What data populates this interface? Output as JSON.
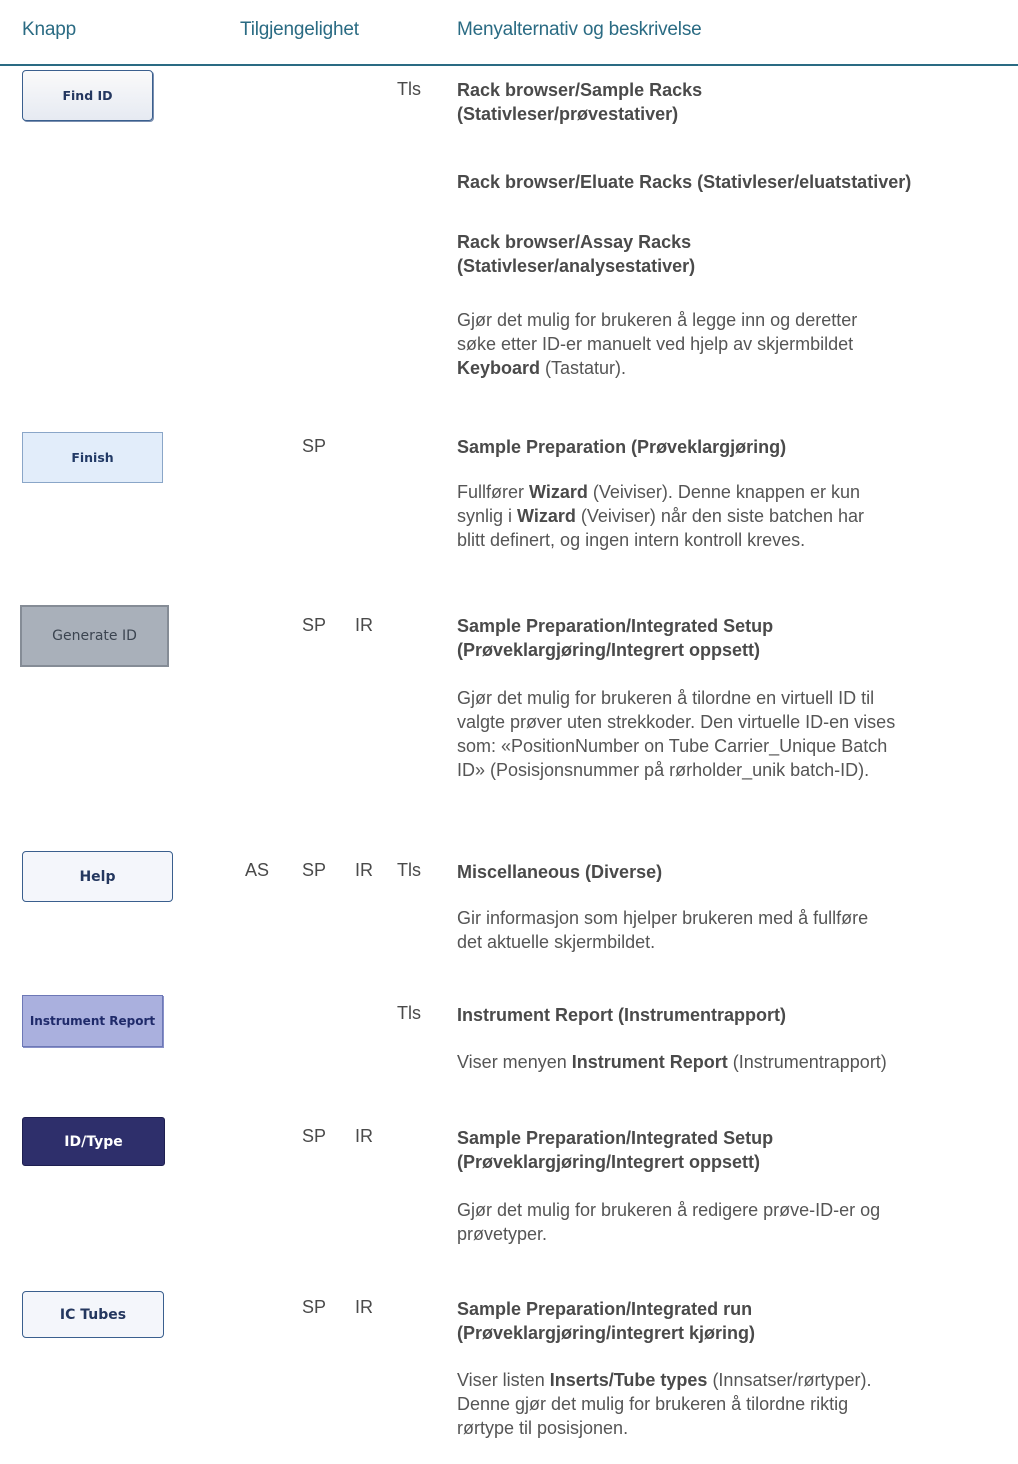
{
  "header": {
    "col_button": "Knapp",
    "col_availability": "Tilgjengelighet",
    "col_menu": "Menyalternativ og beskrivelse"
  },
  "rows": [
    {
      "button": "Find ID",
      "avail": [
        "",
        "",
        "",
        "Tls"
      ],
      "titles": [
        "Rack browser/Sample Racks",
        "(Stativleser/prøvestativer)",
        "Rack browser/Eluate Racks (Stativleser/eluatstativer)",
        "Rack browser/Assay Racks",
        "(Stativleser/analysestativer)"
      ],
      "desc": [
        "Gjør det mulig for brukeren å legge inn og deretter",
        "søke etter ID-er manuelt ved hjelp av skjermbildet",
        "Keyboard",
        " (Tastatur)."
      ]
    },
    {
      "button": "Finish",
      "avail": [
        "",
        "SP",
        "",
        ""
      ],
      "titles": [
        "Sample Preparation (Prøveklargjøring)"
      ],
      "desc": [
        "Fullfører ",
        "Wizard",
        " (Veiviser). Denne knappen er kun",
        "synlig i ",
        "Wizard",
        " (Veiviser) når den siste batchen har",
        "blitt definert, og ingen intern kontroll kreves."
      ]
    },
    {
      "button": "Generate ID",
      "avail": [
        "",
        "SP",
        "IR",
        ""
      ],
      "titles": [
        "Sample Preparation/Integrated Setup",
        "(Prøveklargjøring/Integrert oppsett)"
      ],
      "desc": [
        "Gjør det mulig for brukeren å tilordne en virtuell ID til",
        "valgte prøver uten strekkoder. Den virtuelle ID-en vises",
        "som: «PositionNumber on Tube Carrier_Unique Batch",
        "ID» (Posisjonsnummer på rørholder_unik batch-ID)."
      ]
    },
    {
      "button": "Help",
      "avail": [
        "AS",
        "SP",
        "IR",
        "Tls"
      ],
      "titles": [
        "Miscellaneous (Diverse)"
      ],
      "desc": [
        "Gir informasjon som hjelper brukeren med å fullføre",
        "det aktuelle skjermbildet."
      ]
    },
    {
      "button": "Instrument Report",
      "avail": [
        "",
        "",
        "",
        "Tls"
      ],
      "titles": [
        "Instrument Report (Instrumentrapport)"
      ],
      "desc": [
        "Viser menyen ",
        "Instrument Report",
        " (Instrumentrapport)"
      ]
    },
    {
      "button": "ID/Type",
      "avail": [
        "",
        "SP",
        "IR",
        ""
      ],
      "titles": [
        "Sample Preparation/Integrated Setup",
        "(Prøveklargjøring/Integrert oppsett)"
      ],
      "desc": [
        "Gjør det mulig for brukeren å redigere prøve-ID-er og",
        "prøvetyper."
      ]
    },
    {
      "button": "IC Tubes",
      "avail": [
        "",
        "SP",
        "IR",
        ""
      ],
      "titles": [
        "Sample Preparation/Integrated run",
        "(Prøveklargjøring/integrert kjøring)"
      ],
      "desc": [
        "Viser listen ",
        "Inserts/Tube types",
        " (Innsatser/rørtyper).",
        "Denne gjør det mulig for brukeren å tilordne riktig",
        "rørtype til posisjonen."
      ]
    }
  ]
}
